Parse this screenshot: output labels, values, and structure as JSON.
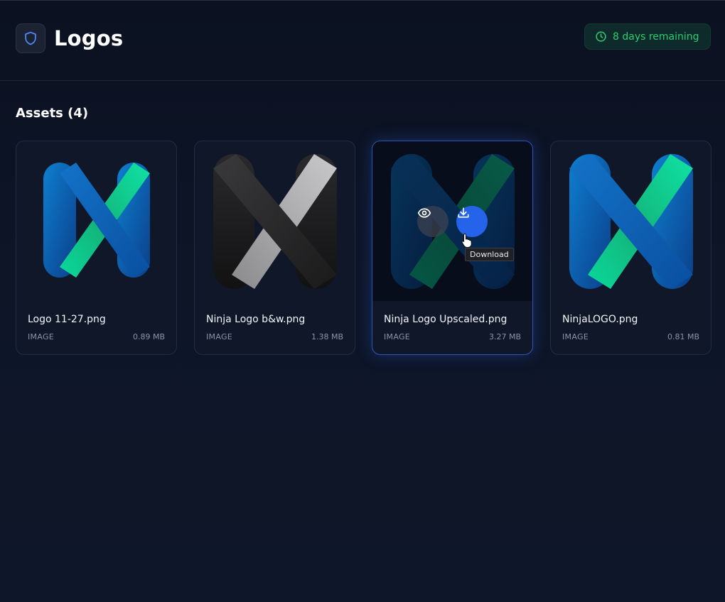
{
  "header": {
    "title": "Logos",
    "badge_icon": "shield-icon",
    "timer_icon": "clock-icon",
    "timer_text": "8 days remaining",
    "timer_color": "#2ecc71"
  },
  "assets": {
    "heading": "Assets (4)",
    "items": [
      {
        "name": "Logo 11-27.png",
        "type": "IMAGE",
        "size": "0.89 MB"
      },
      {
        "name": "Ninja Logo b&w.png",
        "type": "IMAGE",
        "size": "1.38 MB"
      },
      {
        "name": "Ninja Logo Upscaled.png",
        "type": "IMAGE",
        "size": "3.27 MB"
      },
      {
        "name": "NinjaLOGO.png",
        "type": "IMAGE",
        "size": "0.81 MB"
      }
    ]
  },
  "hover_actions": {
    "preview_icon": "eye-icon",
    "download_icon": "download-icon",
    "tooltip": "Download"
  },
  "colors": {
    "accent": "#2563eb",
    "background": "#0b1120",
    "card": "#0f1729"
  }
}
